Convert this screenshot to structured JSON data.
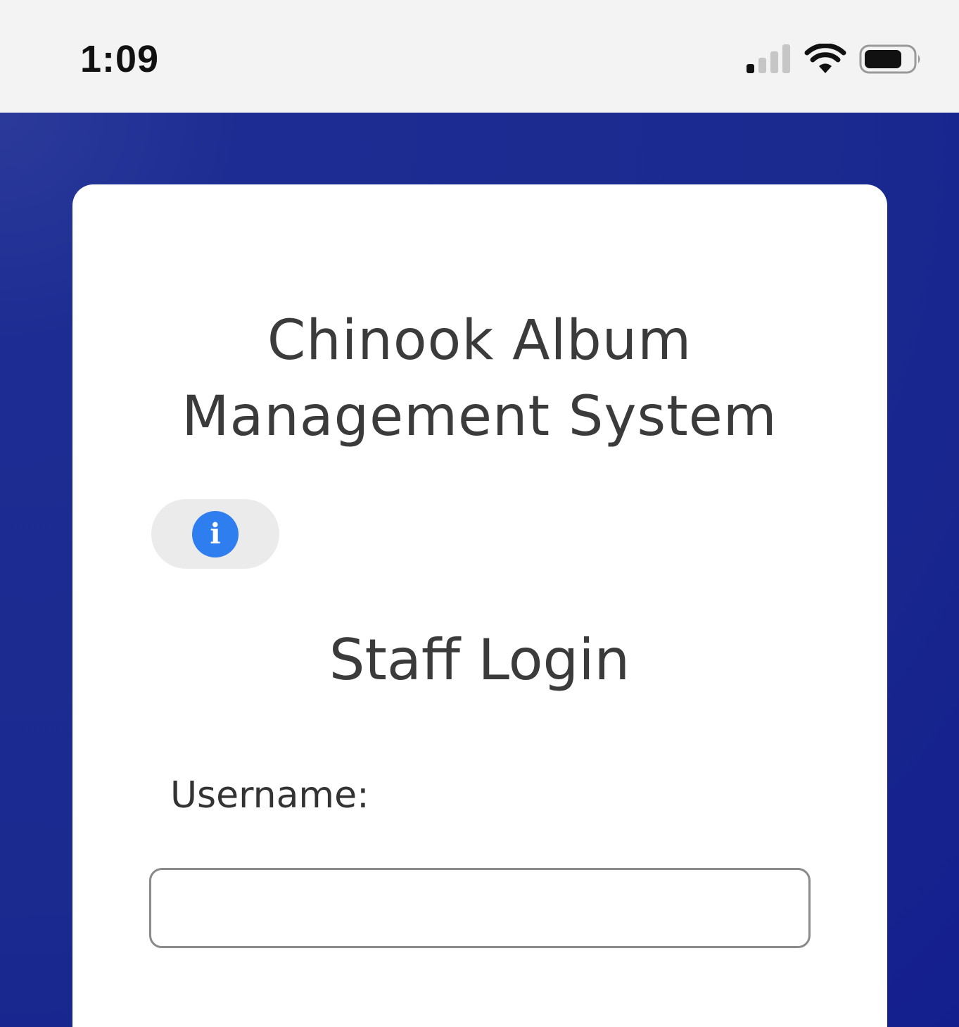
{
  "status_bar": {
    "time": "1:09",
    "icons": [
      "cellular-signal-icon",
      "wifi-icon",
      "battery-icon"
    ]
  },
  "colors": {
    "background_blue": "#1a2a8f",
    "card": "#ffffff",
    "info_icon": "#2f7ef0",
    "text": "#3b3b3b"
  },
  "app": {
    "title_line1": "Chinook Album",
    "title_line2": "Management System"
  },
  "info_button": {
    "icon": "info-icon",
    "glyph": "i"
  },
  "login": {
    "heading": "Staff Login",
    "username_label": "Username:",
    "username_value": "",
    "username_placeholder": ""
  }
}
